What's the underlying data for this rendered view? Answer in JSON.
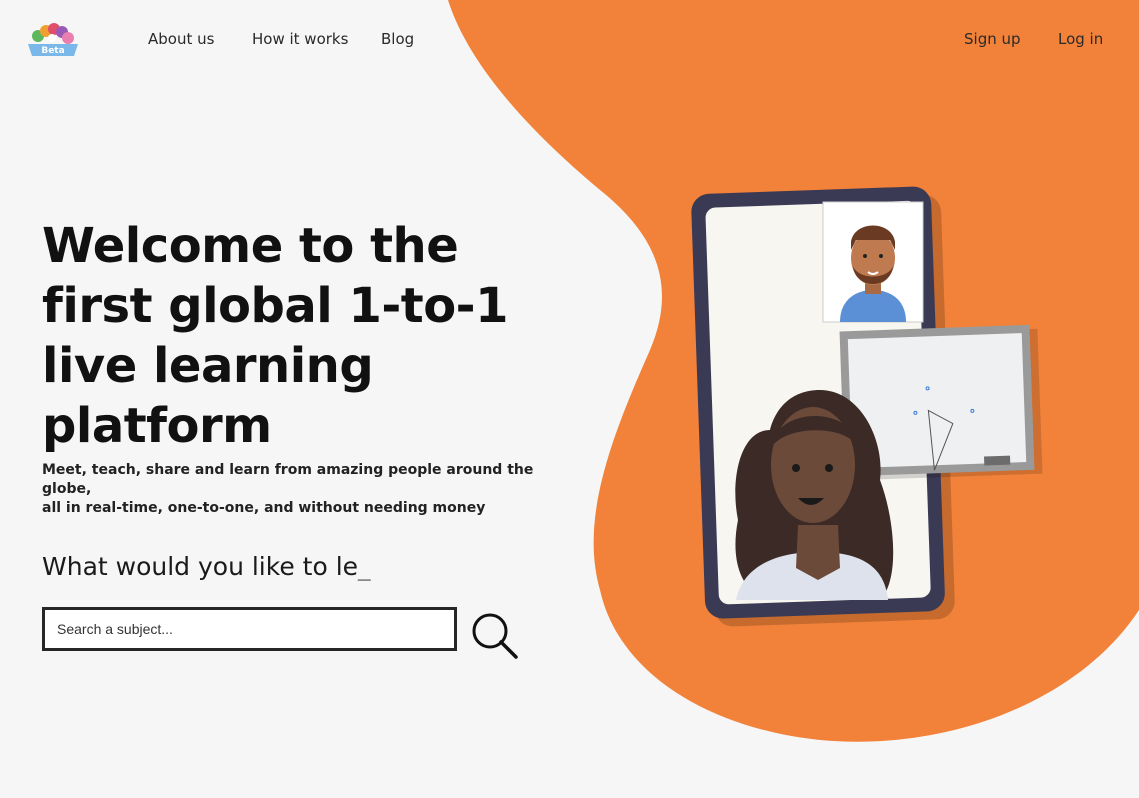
{
  "header": {
    "logo": {
      "name": "app-logo",
      "text": "Beta"
    },
    "nav": {
      "about_label": "About us",
      "how_label": "How it works",
      "blog_label": "Blog"
    },
    "auth": {
      "signup_label": "Sign up",
      "login_label": "Log in"
    }
  },
  "hero": {
    "title": "Welcome to the first global 1-to-1 live learning platform",
    "subtitle_line1": "Meet, teach, share and learn from amazing people around the globe,",
    "subtitle_line2": "all in real-time, one-to-one, and without needing money",
    "question_text": "What would you like to le",
    "question_cursor": "_"
  },
  "search": {
    "placeholder": "Search a subject...",
    "value": "",
    "icon": "search-icon"
  },
  "colors": {
    "accent_orange": "#f28239",
    "background": "#f6f6f6",
    "text": "#111111",
    "phone_frame": "#3b3a55"
  }
}
